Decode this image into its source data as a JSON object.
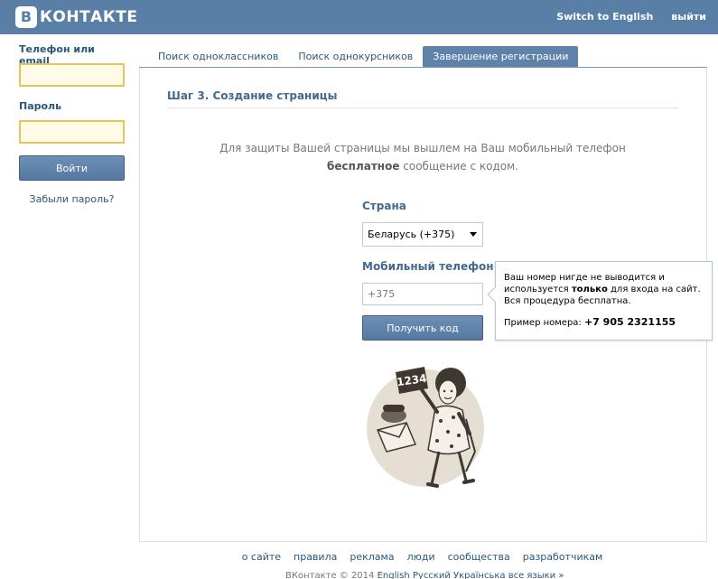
{
  "header": {
    "logo_badge": "B",
    "logo_text": "КОНТАКТЕ",
    "switch_language": "Switch to English",
    "logout": "выйти",
    "bg_color": "#5a7fa6"
  },
  "login": {
    "phone_label": "Телефон или email",
    "phone_value": "",
    "password_label": "Пароль",
    "password_value": "",
    "submit_label": "Войти",
    "forgot_link": "Забыли пароль?"
  },
  "tabs": [
    {
      "label": "Поиск одноклассников",
      "active": false
    },
    {
      "label": "Поиск однокурсников",
      "active": false
    },
    {
      "label": "Завершение регистрации",
      "active": true
    }
  ],
  "main": {
    "step_title": "Шаг 3. Создание страницы",
    "info_line1": "Для защиты Вашей страницы мы вышлем на Ваш мобильный телефон",
    "info_bold": "бесплатное",
    "info_line2_rest": " сообщение с кодом.",
    "country_label": "Страна",
    "country_value": "Беларусь (+375)",
    "phone_label": "Мобильный телефон",
    "phone_value": "+375",
    "get_code_button": "Получить код",
    "illustration_code": "1234"
  },
  "tooltip": {
    "line_part1": "Ваш номер нигде не выводится и используется ",
    "line_bold": "только",
    "line_part2": " для входа на сайт. Вся процедура бесплатна.",
    "example_label": "Пример номера: ",
    "example_number": "+7 905 2321155"
  },
  "footer": {
    "links": [
      "о сайте",
      "правила",
      "реклама",
      "люди",
      "сообщества",
      "разработчикам"
    ],
    "copyright_prefix": "ВКонтакте © 2014 ",
    "lang_links": "English Русский Українська все языки »"
  }
}
